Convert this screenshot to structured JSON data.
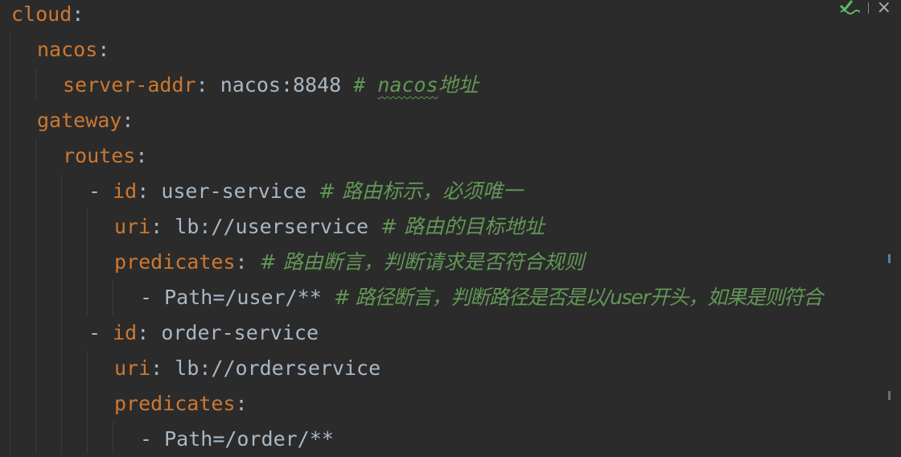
{
  "editor": {
    "lines": [
      {
        "key": "cloud",
        "colon": ":",
        "value": "",
        "comment": ""
      },
      {
        "key": "nacos",
        "colon": ":",
        "value": "",
        "comment": ""
      },
      {
        "key": "server-addr",
        "colon": ":",
        "value": " nacos:8848 ",
        "comment_hash": "# ",
        "comment_word": "nacos",
        "comment_rest": "地址"
      },
      {
        "key": "gateway",
        "colon": ":",
        "value": "",
        "comment": ""
      },
      {
        "key": "routes",
        "colon": ":",
        "value": "",
        "comment": ""
      },
      {
        "dash": "- ",
        "key": "id",
        "colon": ":",
        "value": " user-service ",
        "comment": "# 路由标示，必须唯一"
      },
      {
        "key": "uri",
        "colon": ":",
        "value": " lb://userservice ",
        "comment": "# 路由的目标地址"
      },
      {
        "key": "predicates",
        "colon": ":",
        "value": " ",
        "comment": "# 路由断言，判断请求是否符合规则"
      },
      {
        "dash": "- ",
        "key": "",
        "colon": "",
        "value": "Path=/user/** ",
        "comment": "# 路径断言，判断路径是否是以/user开头，如果是则符合"
      },
      {
        "dash": "- ",
        "key": "id",
        "colon": ":",
        "value": " order-service",
        "comment": ""
      },
      {
        "key": "uri",
        "colon": ":",
        "value": " lb://orderservice",
        "comment": ""
      },
      {
        "key": "predicates",
        "colon": ":",
        "value": "",
        "comment": ""
      },
      {
        "dash": "- ",
        "key": "",
        "colon": "",
        "value": "Path=/order/**",
        "comment": ""
      }
    ]
  },
  "toolbar": {
    "inspection_icon": "check-icon",
    "close_icon": "close-icon",
    "close_glyph": "×"
  },
  "colors": {
    "background": "#2b2b2b",
    "key": "#cc7832",
    "text": "#a9b7c6",
    "comment": "#629755"
  }
}
